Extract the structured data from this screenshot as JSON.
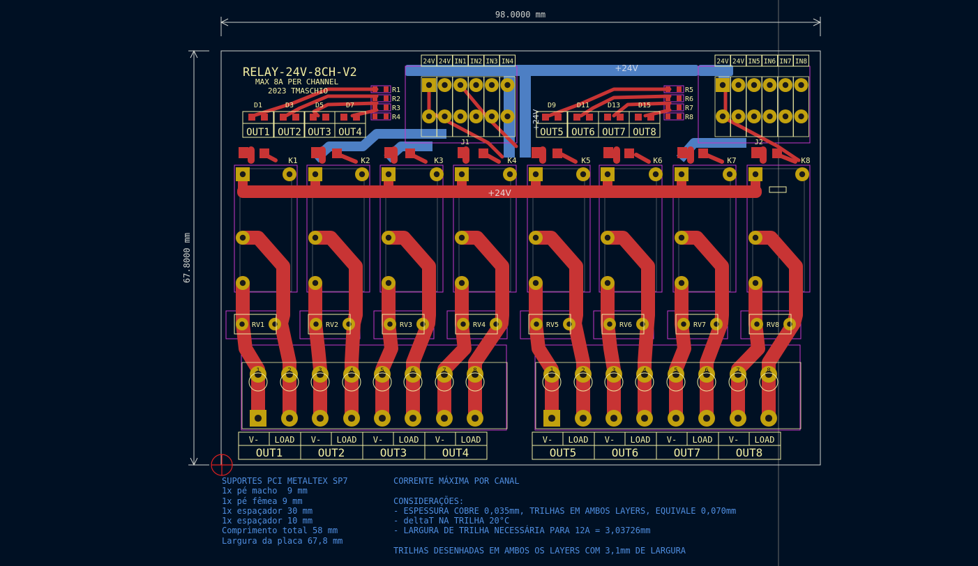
{
  "dimensions": {
    "width_label": "98.0000 mm",
    "height_label": "67.8000 mm"
  },
  "board": {
    "title": "RELAY-24V-8CH-V2",
    "subtitle": "MAX 8A PER CHANNEL",
    "author": "2023 TMASCHIO",
    "net_top": "+24V",
    "net_mid": "+24V",
    "net_side": "+24V"
  },
  "connector_j1": {
    "ref": "J1",
    "pins": [
      "24V",
      "24V",
      "IN1",
      "IN2",
      "IN3",
      "IN4"
    ]
  },
  "connector_j2": {
    "ref": "J2",
    "pins": [
      "24V",
      "24V",
      "IN5",
      "IN6",
      "IN7",
      "IN8"
    ]
  },
  "resistors_left": [
    "R1",
    "R2",
    "R3",
    "R4"
  ],
  "resistors_right": [
    "R5",
    "R6",
    "R7",
    "R8"
  ],
  "diodes": [
    "D1",
    "D3",
    "D5",
    "D7",
    "D9",
    "D11",
    "D13",
    "D15"
  ],
  "led_outputs": [
    "OUT1",
    "OUT2",
    "OUT3",
    "OUT4",
    "OUT5",
    "OUT6",
    "OUT7",
    "OUT8"
  ],
  "relays": [
    "K1",
    "K2",
    "K3",
    "K4",
    "K5",
    "K6",
    "K7",
    "K8"
  ],
  "varistors": [
    "RV1",
    "RV2",
    "RV3",
    "RV4",
    "RV5",
    "RV6",
    "RV7",
    "RV8"
  ],
  "terminal_pins": [
    "1",
    "2",
    "3",
    "4",
    "5",
    "6",
    "7",
    "8"
  ],
  "terminal_labels": {
    "vminus": "V-",
    "load": "LOAD"
  },
  "outputs": [
    "OUT1",
    "OUT2",
    "OUT3",
    "OUT4",
    "OUT5",
    "OUT6",
    "OUT7",
    "OUT8"
  ],
  "notes_left": [
    "SUPORTES PCI METALTEX SP7",
    "1x pé macho  9 mm",
    "1x pé fêmea 9 mm",
    "1x espaçador 30 mm",
    "1x espaçador 10 mm",
    "Comprimento total 58 mm",
    "Largura da placa 67,8 mm"
  ],
  "notes_right": [
    "CORRENTE MÁXIMA POR CANAL",
    "",
    "CONSIDERAÇÕES:",
    "- ESPESSURA COBRE 0,035mm, TRILHAS EM AMBOS LAYERS, EQUIVALE 0,070mm",
    "- deltaT NA TRILHA 20°C",
    "- LARGURA DE TRILHA NECESSÁRIA PARA 12A = 3,03726mm",
    "",
    "TRILHAS DESENHADAS EM AMBOS OS LAYERS COM 3,1mm DE LARGURA"
  ],
  "colors": {
    "background": "#001023",
    "front_copper": "#c83434",
    "back_copper": "#4d7fc4",
    "pad": "#c2a10e",
    "silkscreen": "#f2eda1",
    "courtyard": "#c836c8",
    "edge_cuts": "#d0d2cd",
    "notes": "#4f8ee0"
  }
}
